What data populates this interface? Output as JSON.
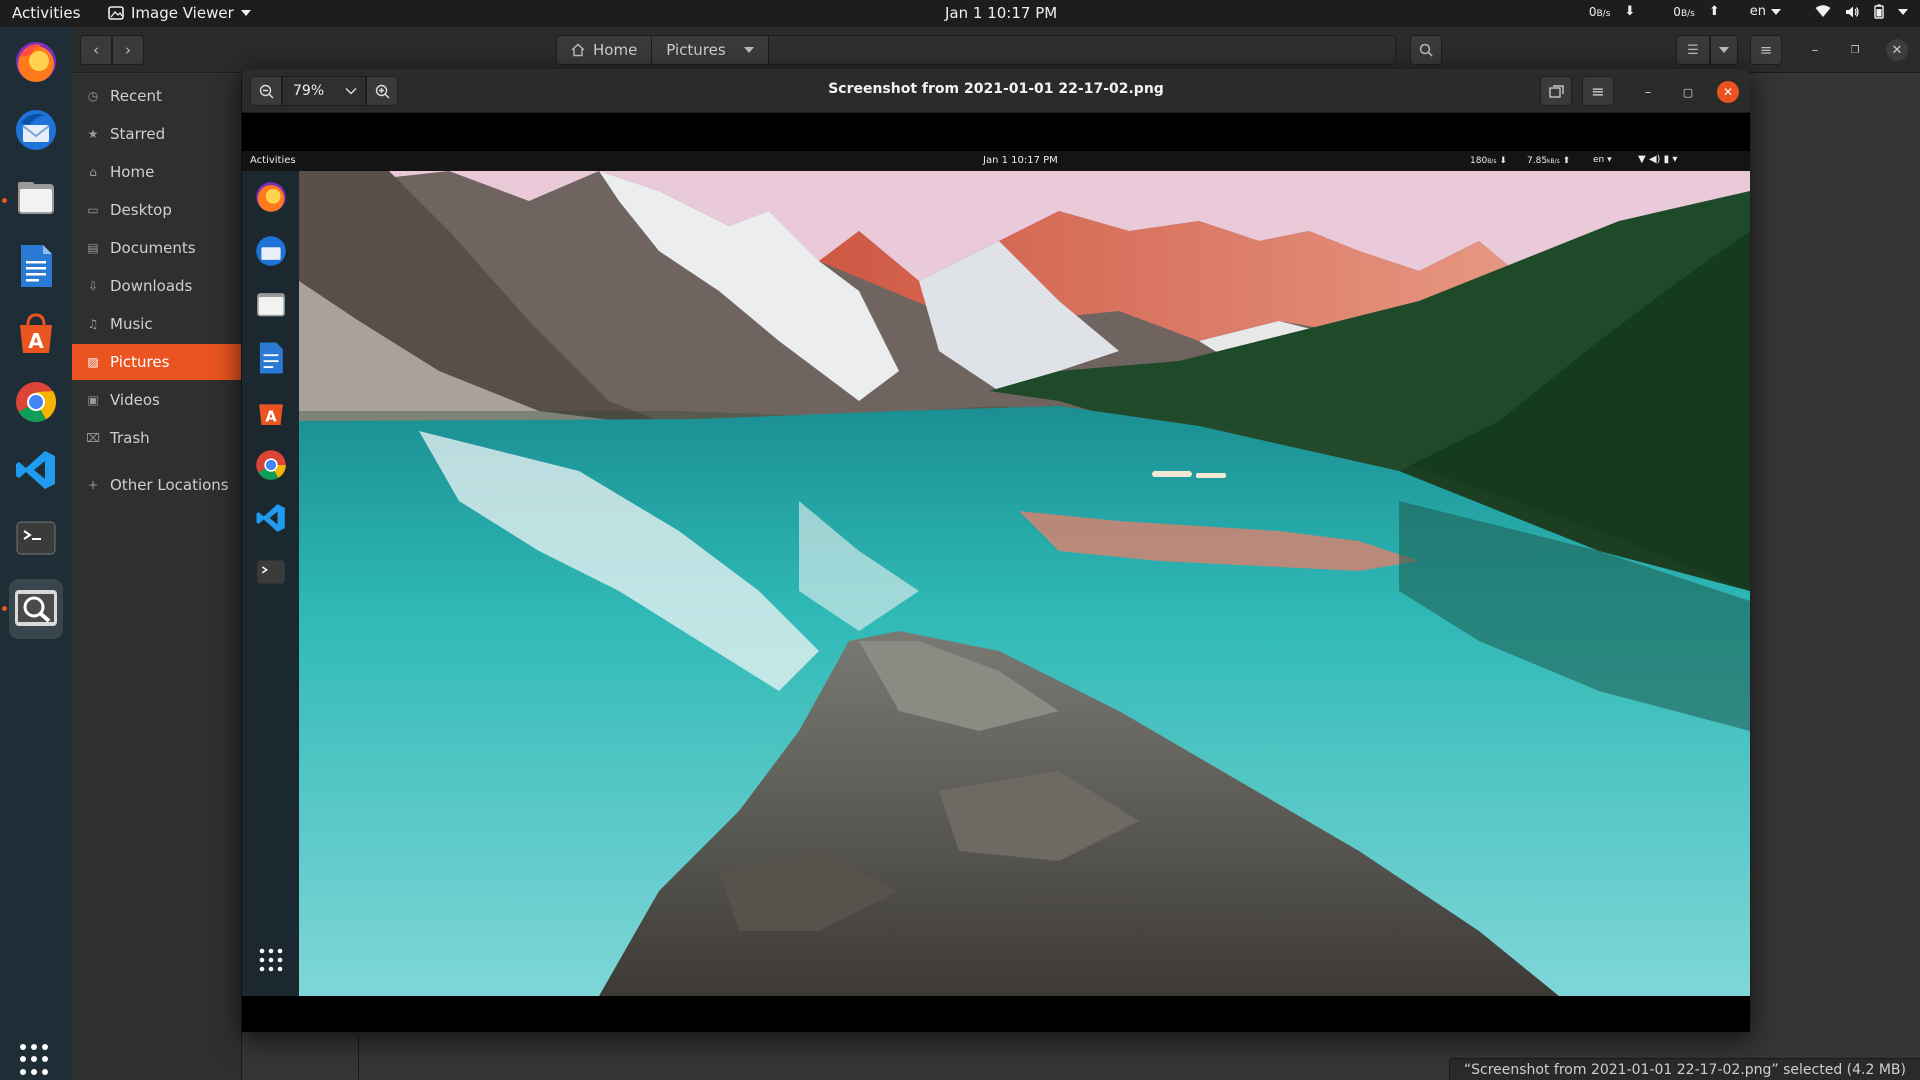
{
  "topbar": {
    "activities": "Activities",
    "app_name": "Image Viewer",
    "clock": "Jan 1  10:17 PM",
    "net_down": "0",
    "net_down_unit": "B/s",
    "net_up": "0",
    "net_up_unit": "B/s",
    "lang": "en"
  },
  "dock": {
    "apps": [
      "firefox",
      "thunderbird",
      "files",
      "libreoffice-writer",
      "ubuntu-software",
      "chrome",
      "vscode",
      "terminal",
      "image-viewer"
    ]
  },
  "files": {
    "path": [
      "Home",
      "Pictures"
    ],
    "sidebar": [
      {
        "label": "Recent",
        "icon": "clock-icon"
      },
      {
        "label": "Starred",
        "icon": "star-icon"
      },
      {
        "label": "Home",
        "icon": "home-icon"
      },
      {
        "label": "Desktop",
        "icon": "desktop-icon"
      },
      {
        "label": "Documents",
        "icon": "document-icon"
      },
      {
        "label": "Downloads",
        "icon": "download-icon"
      },
      {
        "label": "Music",
        "icon": "music-icon"
      },
      {
        "label": "Pictures",
        "icon": "picture-icon"
      },
      {
        "label": "Videos",
        "icon": "video-icon"
      },
      {
        "label": "Trash",
        "icon": "trash-icon"
      },
      {
        "label": "Other Locations",
        "icon": "plus-icon"
      }
    ],
    "selected_sidebar": "Pictures",
    "status": "“Screenshot from 2021-01-01 22-17-02.png” selected  (4.2 MB)"
  },
  "viewer": {
    "zoom": "79%",
    "title": "Screenshot from 2021-01-01 22-17-02.png"
  },
  "inner_screenshot": {
    "activities": "Activities",
    "clock": "Jan 1  10:17 PM",
    "net_down": "180",
    "net_down_unit": "B/s",
    "net_up": "7.85",
    "net_up_unit": "kB/s",
    "lang": "en"
  },
  "colors": {
    "accent": "#e95420",
    "panel": "#1d1d1d",
    "dock": "#1f2d36",
    "window": "#353535",
    "lake": "#2fb9b6"
  }
}
